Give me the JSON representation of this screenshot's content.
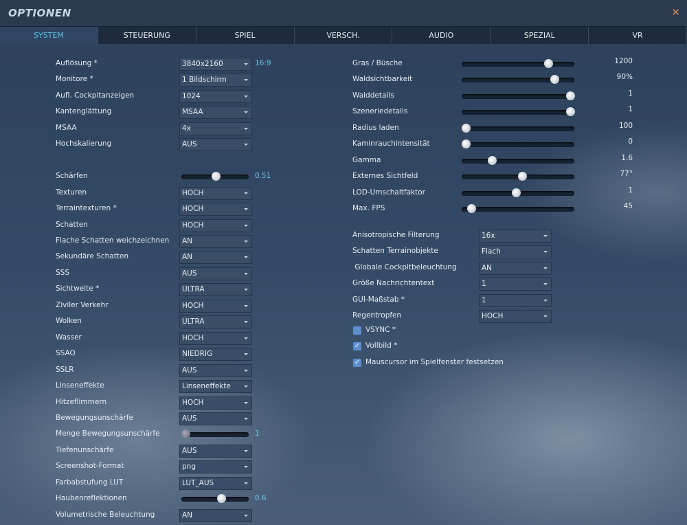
{
  "title": "OPTIONEN",
  "close_icon": "close-icon",
  "tabs": [
    {
      "label": "SYSTEM",
      "active": true
    },
    {
      "label": "STEUERUNG"
    },
    {
      "label": "SPIEL"
    },
    {
      "label": "VERSCH."
    },
    {
      "label": "AUDIO"
    },
    {
      "label": "SPEZIAL"
    },
    {
      "label": "VR"
    }
  ],
  "accent": "#5fc0e8",
  "left": [
    {
      "label": "Auflösung *",
      "type": "dropdown",
      "value": "3840x2160",
      "extra": "16:9"
    },
    {
      "label": "Monitore *",
      "type": "dropdown",
      "value": "1 Bildschirm"
    },
    {
      "label": "Aufl. Cockpitanzeigen",
      "type": "dropdown",
      "value": "1024"
    },
    {
      "label": "Kantenglättung",
      "type": "dropdown",
      "value": "MSAA"
    },
    {
      "label": "MSAA",
      "type": "dropdown",
      "value": "4x"
    },
    {
      "label": "Hochskalierung",
      "type": "dropdown",
      "value": "AUS"
    },
    {
      "label": "Schärfen",
      "type": "slider",
      "fraction": 0.51,
      "value": "0.51",
      "gap": true
    },
    {
      "label": "Texturen",
      "type": "dropdown",
      "value": "HOCH"
    },
    {
      "label": "Terraintexturen *",
      "type": "dropdown",
      "value": "HOCH"
    },
    {
      "label": "Schatten",
      "type": "dropdown",
      "value": "HOCH"
    },
    {
      "label": "Flache Schatten weichzeichnen",
      "type": "dropdown",
      "value": "AN"
    },
    {
      "label": "Sekundäre Schatten",
      "type": "dropdown",
      "value": "AN"
    },
    {
      "label": "SSS",
      "type": "dropdown",
      "value": "AUS"
    },
    {
      "label": "Sichtweite *",
      "type": "dropdown",
      "value": "ULTRA"
    },
    {
      "label": "Ziviler Verkehr",
      "type": "dropdown",
      "value": "HOCH"
    },
    {
      "label": "Wolken",
      "type": "dropdown",
      "value": "ULTRA"
    },
    {
      "label": "Wasser",
      "type": "dropdown",
      "value": "HOCH"
    },
    {
      "label": "SSAO",
      "type": "dropdown",
      "value": "NIEDRIG"
    },
    {
      "label": "SSLR",
      "type": "dropdown",
      "value": "AUS"
    },
    {
      "label": "Linseneffekte",
      "type": "dropdown",
      "value": "Linseneffekte"
    },
    {
      "label": "Hitzeflimmern",
      "type": "dropdown",
      "value": "HOCH"
    },
    {
      "label": "Bewegungsunschärfe",
      "type": "dropdown",
      "value": "AUS"
    },
    {
      "label": "Menge Bewegungsunschärfe",
      "type": "slider",
      "fraction": 0,
      "value": "1",
      "disabled": true
    },
    {
      "label": "Tiefenunschärfe",
      "type": "dropdown",
      "value": "AUS"
    },
    {
      "label": "Screenshot-Format",
      "type": "dropdown",
      "value": "png"
    },
    {
      "label": "Farbabstufung LUT",
      "type": "dropdown",
      "value": "LUT_AUS"
    },
    {
      "label": "Haubenreflektionen",
      "type": "slider",
      "fraction": 0.6,
      "value": "0.6"
    },
    {
      "label": "Volumetrische Beleuchtung",
      "type": "dropdown",
      "value": "AN"
    }
  ],
  "right_sliders": [
    {
      "label": "Gras / Büsche",
      "fraction": 0.79,
      "value": "1200"
    },
    {
      "label": "Waldsichtbarkeit",
      "fraction": 0.85,
      "value": "90%"
    },
    {
      "label": "Walddetails",
      "fraction": 1,
      "value": "1"
    },
    {
      "label": "Szeneriedetails",
      "fraction": 1,
      "value": "1"
    },
    {
      "label": "Radius laden",
      "fraction": 0,
      "value": "100"
    },
    {
      "label": "Kaminrauchintensität",
      "fraction": 0,
      "value": "0"
    },
    {
      "label": "Gamma",
      "fraction": 0.25,
      "value": "1.6"
    },
    {
      "label": "Externes Sichtfeld",
      "fraction": 0.54,
      "value": "77°"
    },
    {
      "label": "LOD-Umschaltfaktor",
      "fraction": 0.48,
      "value": "1"
    },
    {
      "label": "Max. FPS",
      "fraction": 0.05,
      "value": "45"
    }
  ],
  "right_dropdowns": [
    {
      "label": "Anisotropische Filterung",
      "value": "16x"
    },
    {
      "label": "Schatten Terrainobjekte",
      "value": "Flach"
    },
    {
      "label": " Globale Cockpitbeleuchtung",
      "value": "AN"
    },
    {
      "label": "Größe Nachrichtentext",
      "value": "1"
    },
    {
      "label": "GUI-Maßstab *",
      "value": "1"
    },
    {
      "label": "Regentropfen",
      "value": "HOCH"
    }
  ],
  "checkboxes": [
    {
      "label": "VSYNC *",
      "checked": false
    },
    {
      "label": "Vollbild *",
      "checked": true
    },
    {
      "label": "Mauscursor im Spielfenster festsetzen",
      "checked": true
    }
  ]
}
